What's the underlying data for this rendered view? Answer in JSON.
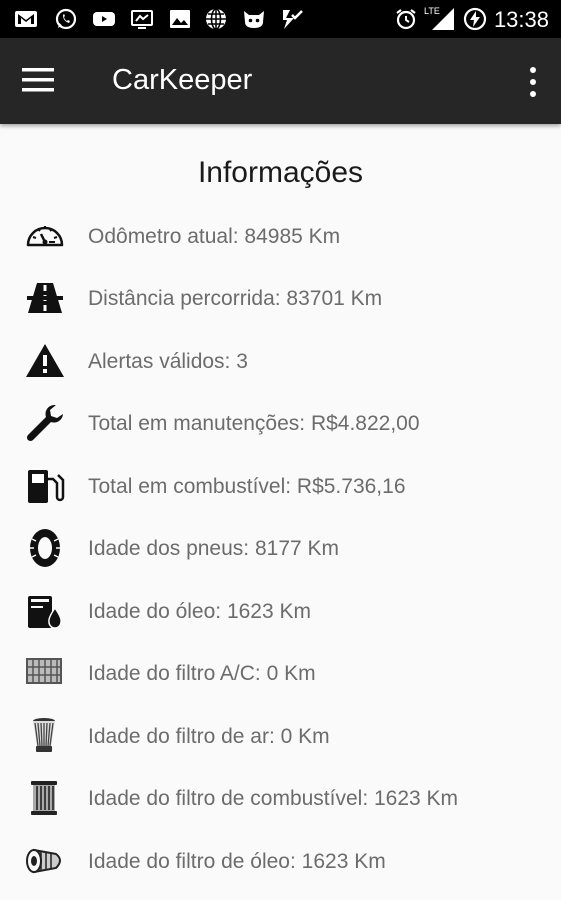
{
  "status_bar": {
    "time": "13:38",
    "network_label": "LTE",
    "icons": [
      "gmail-icon",
      "whatsapp-icon",
      "youtube-icon",
      "cast-icon",
      "gallery-icon",
      "globe-icon",
      "cat-icon",
      "checklist-icon",
      "alarm-icon",
      "signal-icon",
      "battery-charging-icon"
    ]
  },
  "app_bar": {
    "title": "CarKeeper",
    "menu_icon": "hamburger-menu-icon",
    "more_icon": "more-vert-icon"
  },
  "section": {
    "title": "Informações"
  },
  "items": [
    {
      "icon": "speedometer-icon",
      "label": "Odômetro atual: 84985 Km"
    },
    {
      "icon": "road-icon",
      "label": "Distância percorrida: 83701 Km"
    },
    {
      "icon": "warning-icon",
      "label": "Alertas válidos: 3"
    },
    {
      "icon": "wrench-icon",
      "label": "Total em manutenções: R$4.822,00"
    },
    {
      "icon": "fuel-pump-icon",
      "label": "Total em combustível: R$5.736,16"
    },
    {
      "icon": "tire-icon",
      "label": "Idade dos pneus: 8177 Km"
    },
    {
      "icon": "oil-can-icon",
      "label": "Idade do óleo: 1623 Km"
    },
    {
      "icon": "ac-filter-icon",
      "label": "Idade do filtro A/C: 0 Km"
    },
    {
      "icon": "air-filter-icon",
      "label": "Idade do filtro de ar: 0 Km"
    },
    {
      "icon": "fuel-filter-icon",
      "label": "Idade do filtro de combustível: 1623 Km"
    },
    {
      "icon": "oil-filter-icon",
      "label": "Idade do filtro de óleo: 1623 Km"
    }
  ]
}
